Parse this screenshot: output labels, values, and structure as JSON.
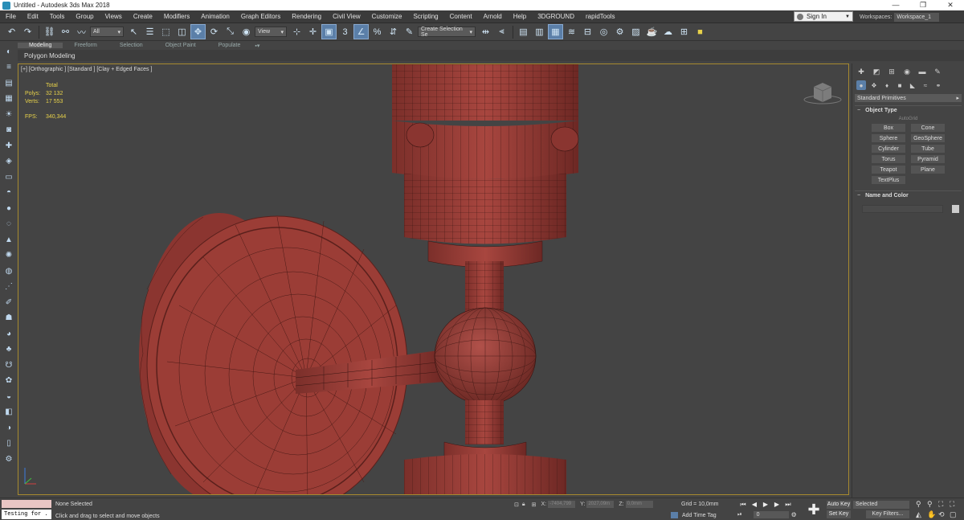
{
  "window": {
    "title": "Untitled - Autodesk 3ds Max 2018",
    "minimize": "—",
    "maximize": "❐",
    "close": "✕"
  },
  "menu": [
    "File",
    "Edit",
    "Tools",
    "Group",
    "Views",
    "Create",
    "Modifiers",
    "Animation",
    "Graph Editors",
    "Rendering",
    "Civil View",
    "Customize",
    "Scripting",
    "Content",
    "Arnold",
    "Help",
    "3DGROUND",
    "rapidTools"
  ],
  "account": {
    "signin": "Sign In",
    "workspaces_label": "Workspaces:",
    "workspace": "Workspace_1"
  },
  "toolbar": {
    "filter": "All",
    "refcoord": "View",
    "selection_set": "Create Selection Se",
    "snap_label": "3"
  },
  "ribbon": {
    "tabs": [
      "Modeling",
      "Freeform",
      "Selection",
      "Object Paint",
      "Populate"
    ],
    "active": "Modeling",
    "sub": "Polygon Modeling"
  },
  "viewport": {
    "label": "[+] [Orthographic ] [Standard ] [Clay + Edged Faces ]",
    "stats_header": "Total",
    "polys_label": "Polys:",
    "polys": "32 132",
    "verts_label": "Verts:",
    "verts": "17 553",
    "fps_label": "FPS:",
    "fps": "340,344",
    "mesh_color": "#9b3d36",
    "bg_color": "#444444"
  },
  "command_panel": {
    "category": "Standard Primitives",
    "object_type_title": "Object Type",
    "autogrid": "AutoGrid",
    "buttons": [
      "Box",
      "Cone",
      "Sphere",
      "GeoSphere",
      "Cylinder",
      "Tube",
      "Torus",
      "Pyramid",
      "Teapot",
      "Plane",
      "TextPlus"
    ],
    "name_color_title": "Name and Color"
  },
  "status": {
    "maxscript": "Testing for .",
    "selection": "None Selected",
    "prompt": "Click and drag to select and move objects",
    "x_label": "X:",
    "x": "-7404,799",
    "y_label": "Y:",
    "y": "2027,09m",
    "z_label": "Z:",
    "z": "0,0mm",
    "grid": "Grid = 10,0mm",
    "add_time_tag": "Add Time Tag",
    "frame": "0",
    "auto_key": "Auto Key",
    "set_key": "Set Key",
    "selected": "Selected",
    "key_filters": "Key Filters..."
  }
}
